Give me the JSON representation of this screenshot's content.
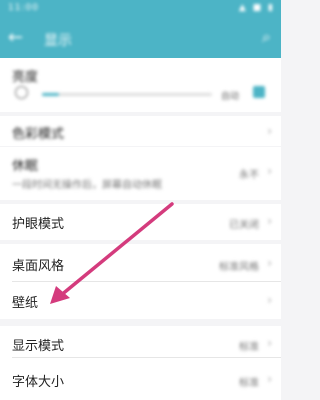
{
  "status": {
    "time": "11:00",
    "icons": "▲ ■ ▮"
  },
  "appbar": {
    "title": "显示",
    "back": "←",
    "search": "⌕"
  },
  "brightness": {
    "label": "亮度",
    "auto": "自动"
  },
  "rows": [
    {
      "label": "色彩模式",
      "value": "",
      "sub": ""
    },
    {
      "label": "休眠",
      "value": "永不",
      "sub": "一段时间无操作后，屏幕自动休眠"
    },
    {
      "label": "护眼模式",
      "value": "已关闭",
      "sub": ""
    },
    {
      "label": "桌面风格",
      "value": "标准风格",
      "sub": ""
    },
    {
      "label": "壁纸",
      "value": "",
      "sub": ""
    },
    {
      "label": "显示模式",
      "value": "标准",
      "sub": ""
    },
    {
      "label": "字体大小",
      "value": "标准",
      "sub": ""
    }
  ],
  "chevron": "›",
  "colors": {
    "primary": "#4cb4c6",
    "arrow": "#d43b7d"
  },
  "brightness_level": 0.1
}
